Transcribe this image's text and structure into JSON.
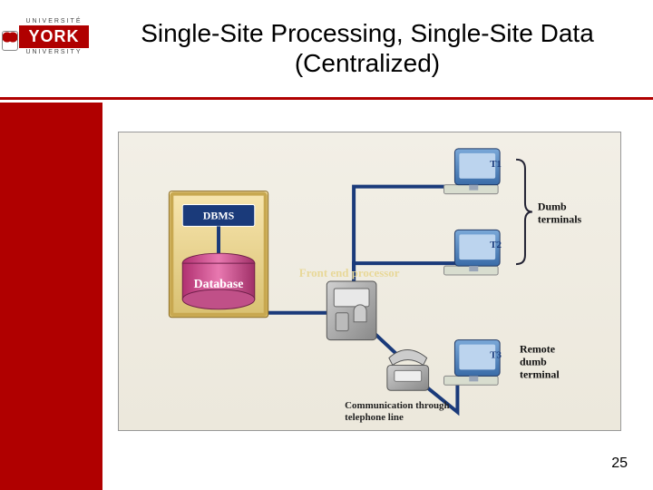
{
  "logo": {
    "top": "UNIVERSITÉ",
    "mid": "YORK",
    "bot": "UNIVERSITY"
  },
  "title": "Single-Site Processing, Single-Site Data (Centralized)",
  "page_number": "25",
  "diagram": {
    "dbms": "DBMS",
    "database": "Database",
    "fep": "Front end processor",
    "t1": "T1",
    "t2": "T2",
    "t3": "T3",
    "dumb_terminals": "Dumb terminals",
    "remote_terminal": "Remote dumb terminal",
    "comm_line": "Communication through telephone line"
  }
}
